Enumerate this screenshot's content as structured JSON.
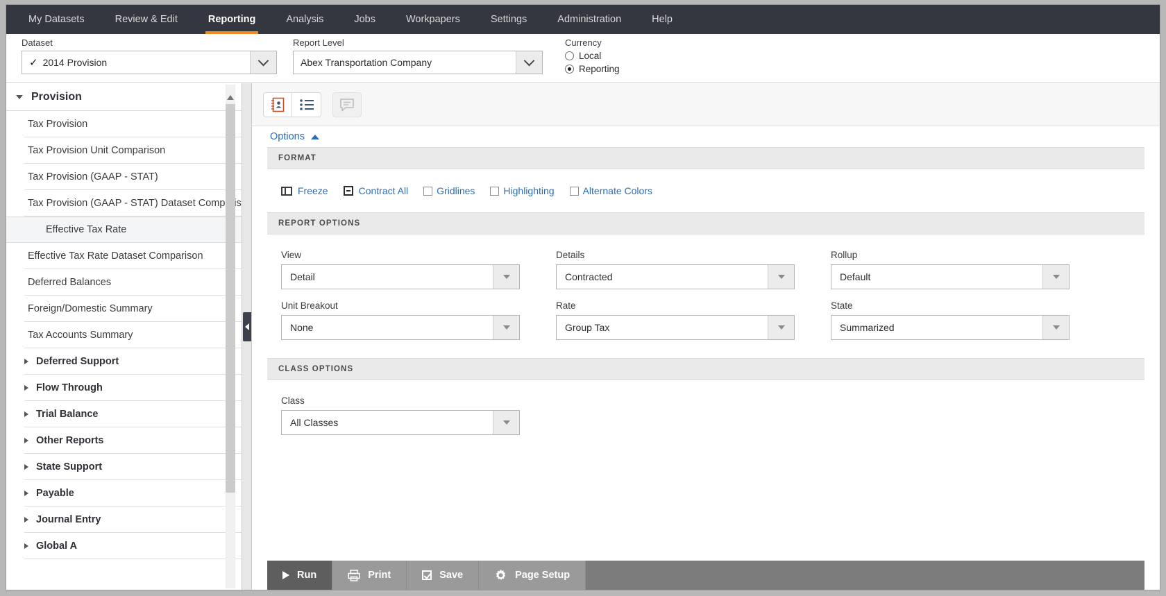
{
  "topnav": {
    "items": [
      {
        "label": "My Datasets",
        "active": false
      },
      {
        "label": "Review & Edit",
        "active": false
      },
      {
        "label": "Reporting",
        "active": true
      },
      {
        "label": "Analysis",
        "active": false
      },
      {
        "label": "Jobs",
        "active": false
      },
      {
        "label": "Workpapers",
        "active": false
      },
      {
        "label": "Settings",
        "active": false
      },
      {
        "label": "Administration",
        "active": false
      },
      {
        "label": "Help",
        "active": false
      }
    ],
    "accent_color": "#f08b1d",
    "bg_color": "#34373f"
  },
  "filters": {
    "dataset": {
      "label": "Dataset",
      "value": "2014 Provision",
      "checked_mark": "✓"
    },
    "report_level": {
      "label": "Report Level",
      "value": "Abex Transportation Company"
    },
    "currency": {
      "label": "Currency",
      "options": [
        {
          "label": "Local",
          "selected": false
        },
        {
          "label": "Reporting",
          "selected": true
        }
      ]
    }
  },
  "sidebar": {
    "root_label": "Provision",
    "items": [
      {
        "label": "Tax Provision",
        "type": "leaf",
        "selected": false
      },
      {
        "label": "Tax Provision Unit Comparison",
        "type": "leaf",
        "selected": false
      },
      {
        "label": "Tax Provision (GAAP - STAT)",
        "type": "leaf",
        "selected": false
      },
      {
        "label": "Tax Provision (GAAP - STAT) Dataset Comparison",
        "type": "leaf",
        "selected": false
      },
      {
        "label": "Effective Tax Rate",
        "type": "leaf",
        "selected": true
      },
      {
        "label": "Effective Tax Rate Dataset Comparison",
        "type": "leaf",
        "selected": false
      },
      {
        "label": "Deferred Balances",
        "type": "leaf",
        "selected": false
      },
      {
        "label": "Foreign/Domestic Summary",
        "type": "leaf",
        "selected": false
      },
      {
        "label": "Tax Accounts Summary",
        "type": "leaf",
        "selected": false
      },
      {
        "label": "Deferred Support",
        "type": "group",
        "selected": false
      },
      {
        "label": "Flow Through",
        "type": "group",
        "selected": false
      },
      {
        "label": "Trial Balance",
        "type": "group",
        "selected": false
      },
      {
        "label": "Other Reports",
        "type": "group",
        "selected": false
      },
      {
        "label": "State Support",
        "type": "group",
        "selected": false
      },
      {
        "label": "Payable",
        "type": "group",
        "selected": false
      },
      {
        "label": "Journal Entry",
        "type": "group",
        "selected": false
      },
      {
        "label": "Global A",
        "type": "group",
        "selected": false
      }
    ]
  },
  "toolbar": {
    "buttons": [
      {
        "icon": "report-view-icon",
        "active": true,
        "disabled": false
      },
      {
        "icon": "list-view-icon",
        "active": false,
        "disabled": false
      },
      {
        "icon": "comment-icon",
        "active": false,
        "disabled": true
      }
    ]
  },
  "options_panel": {
    "toggle_label": "Options",
    "expanded": true
  },
  "format": {
    "header": "FORMAT",
    "freeze_label": "Freeze",
    "contract_all_label": "Contract All",
    "checkboxes": [
      {
        "label": "Gridlines",
        "checked": false
      },
      {
        "label": "Highlighting",
        "checked": false
      },
      {
        "label": "Alternate Colors",
        "checked": false
      }
    ]
  },
  "report_options": {
    "header": "REPORT OPTIONS",
    "fields": [
      {
        "label": "View",
        "value": "Detail"
      },
      {
        "label": "Details",
        "value": "Contracted"
      },
      {
        "label": "Rollup",
        "value": "Default"
      },
      {
        "label": "Unit Breakout",
        "value": "None"
      },
      {
        "label": "Rate",
        "value": "Group Tax"
      },
      {
        "label": "State",
        "value": "Summarized"
      }
    ]
  },
  "class_options": {
    "header": "CLASS OPTIONS",
    "field": {
      "label": "Class",
      "value": "All Classes"
    }
  },
  "action_bar": {
    "buttons": [
      {
        "label": "Run",
        "icon": "play-icon",
        "primary": true
      },
      {
        "label": "Print",
        "icon": "printer-icon",
        "primary": false
      },
      {
        "label": "Save",
        "icon": "checkbox-icon",
        "primary": false
      },
      {
        "label": "Page Setup",
        "icon": "gear-icon",
        "primary": false
      }
    ]
  }
}
